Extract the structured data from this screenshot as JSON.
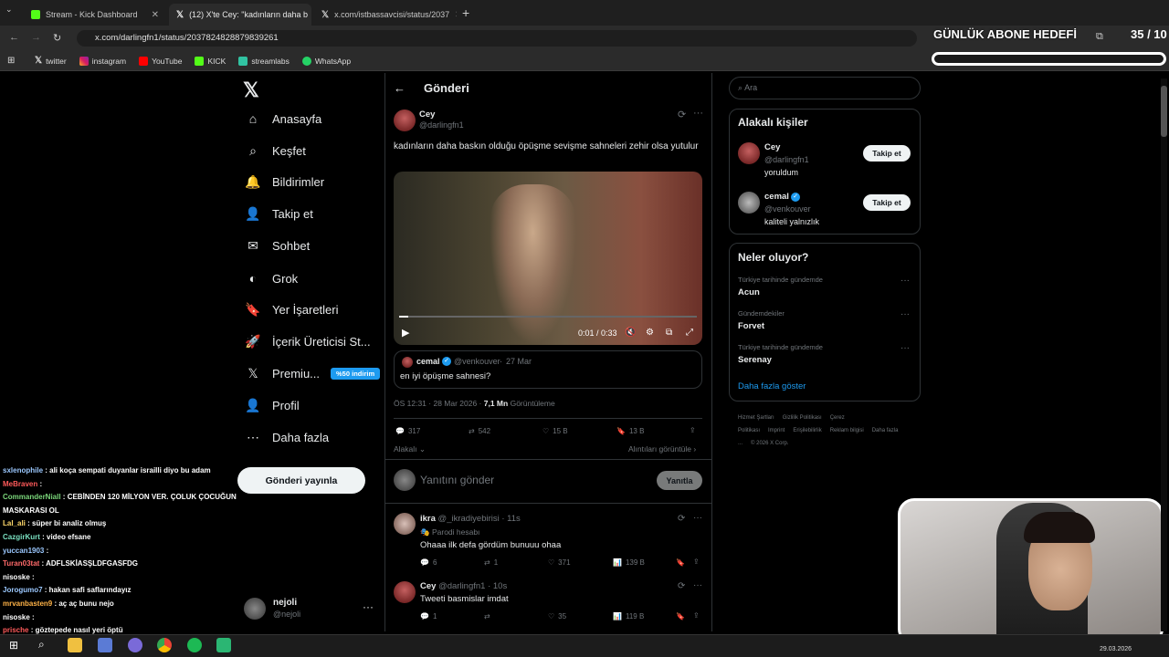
{
  "browser": {
    "tabs": [
      {
        "label": "Stream - Kick Dashboard"
      },
      {
        "label": "(12) X'te Cey: \"kadınların daha b"
      },
      {
        "label": "x.com/istbassavcisi/status/2037"
      }
    ],
    "url": "x.com/darlingfn1/status/2037824828879839261",
    "bookmarks": [
      "twitter",
      "instagram",
      "YouTube",
      "KICK",
      "streamlabs",
      "WhatsApp"
    ]
  },
  "overlay": {
    "goal_title": "GÜNLÜK ABONE HEDEFİ",
    "goal_count": "35 / 10",
    "goal_progress": 1.0
  },
  "nav": {
    "items": [
      "Anasayfa",
      "Keşfet",
      "Bildirimler",
      "Takip et",
      "Sohbet",
      "Grok",
      "Yer İşaretleri",
      "İçerik Üreticisi St...",
      "Premiu...",
      "Profil",
      "Daha fazla"
    ],
    "premium_badge": "%50 indirim",
    "post_button": "Gönderi yayınla",
    "account_name": "nejoli",
    "account_handle": "@nejoli"
  },
  "post": {
    "header": "Gönderi",
    "author": "Cey",
    "handle": "@darlingfn1",
    "text": "kadınların daha baskın olduğu öpüşme sevişme sahneleri zehir olsa yutulur",
    "video_time": "0:01 / 0:33",
    "video_progress": 0.03,
    "quote": {
      "author": "cemal",
      "handle": "@venkouver",
      "date": "27 Mar",
      "text": "en iyi öpüşme sahnesi?"
    },
    "meta_time": "ÖS 12:31 · 28 Mar 2026 · ",
    "views": "7,1 Mn",
    "views_label": "Görüntüleme",
    "stats": {
      "replies": "317",
      "reposts": "542",
      "likes": "15 B",
      "bookmarks": "13 B"
    },
    "relevance": "Alakalı",
    "quotes_link": "Alıntıları görüntüle",
    "reply_placeholder": "Yanıtını gönder",
    "reply_button": "Yanıtla"
  },
  "replies": [
    {
      "author": "ikra",
      "handle": "@_ikradiyebirisi · 11s",
      "badge": "Parodi hesabı",
      "text": "Ohaaa ilk defa gördüm bunuuu ohaa",
      "replies": "6",
      "reposts": "1",
      "likes": "371",
      "views": "139 B"
    },
    {
      "author": "Cey",
      "handle": "@darlingfn1 · 10s",
      "text": "Tweeti basmislar imdat",
      "replies": "1",
      "reposts": "",
      "likes": "35",
      "views": "119 B"
    }
  ],
  "sidebar": {
    "search_placeholder": "Ara",
    "relevant_title": "Alakalı kişiler",
    "people": [
      {
        "name": "Cey",
        "handle": "@darlingfn1",
        "bio": "yoruldum",
        "button": "Takip et"
      },
      {
        "name": "cemal",
        "handle": "@venkouver",
        "bio": "kaliteli yalnızlık",
        "button": "Takip et"
      }
    ],
    "trends_title": "Neler oluyor?",
    "trends": [
      {
        "context": "Türkiye tarihinde gündemde",
        "name": "Acun"
      },
      {
        "context": "Gündemdekiler",
        "name": "Forvet"
      },
      {
        "context": "Türkiye tarihinde gündemde",
        "name": "Serenay"
      }
    ],
    "show_more": "Daha fazla göster",
    "footer": [
      "Hizmet Şartları",
      "Gizlilik Politikası",
      "Çerez Politikası",
      "Imprint",
      "Erişilebilirlik",
      "Reklam bilgisi",
      "Daha fazla ...",
      "© 2026 X Corp."
    ]
  },
  "chat": [
    {
      "user": "sxlenophile",
      "color": "#9bc8ff",
      "msg": " : ali koça sempati duyanlar israilli diyo bu adam"
    },
    {
      "user": "MeBraven",
      "color": "#ff5a5a",
      "msg": " : "
    },
    {
      "user": "CommanderNiall",
      "color": "#7ad67a",
      "msg": " : CEBİNDEN 120 MİLYON VER. ÇOLUK ÇOCUĞUN"
    },
    {
      "user": "",
      "color": "#fff",
      "msg": "MASKARASI OL"
    },
    {
      "user": "Lal_ali",
      "color": "#ffd86b",
      "msg": " : süper bi analiz olmuş"
    },
    {
      "user": "CazgirKurt",
      "color": "#7ae0c0",
      "msg": " : video efsane"
    },
    {
      "user": "yuccan1903",
      "color": "#9bc8ff",
      "msg": " : "
    },
    {
      "user": "Turan03tat",
      "color": "#ff6a6a",
      "msg": " : ADFLSKİASŞLDFGASFDG"
    },
    {
      "user": "nisoske",
      "color": "#ffffff",
      "msg": " : "
    },
    {
      "user": "Jorogumo7",
      "color": "#9bc8ff",
      "msg": " : hakan safi saflarındayız"
    },
    {
      "user": "mrvanbasten9",
      "color": "#ffb347",
      "msg": " : aç aç bunu nejo"
    },
    {
      "user": "nisoske",
      "color": "#ffffff",
      "msg": " : "
    },
    {
      "user": "prische",
      "color": "#ff5a5a",
      "msg": " : göztepede nasıl yeri öptü"
    }
  ],
  "taskbar": {
    "date": "29.03.2026"
  }
}
